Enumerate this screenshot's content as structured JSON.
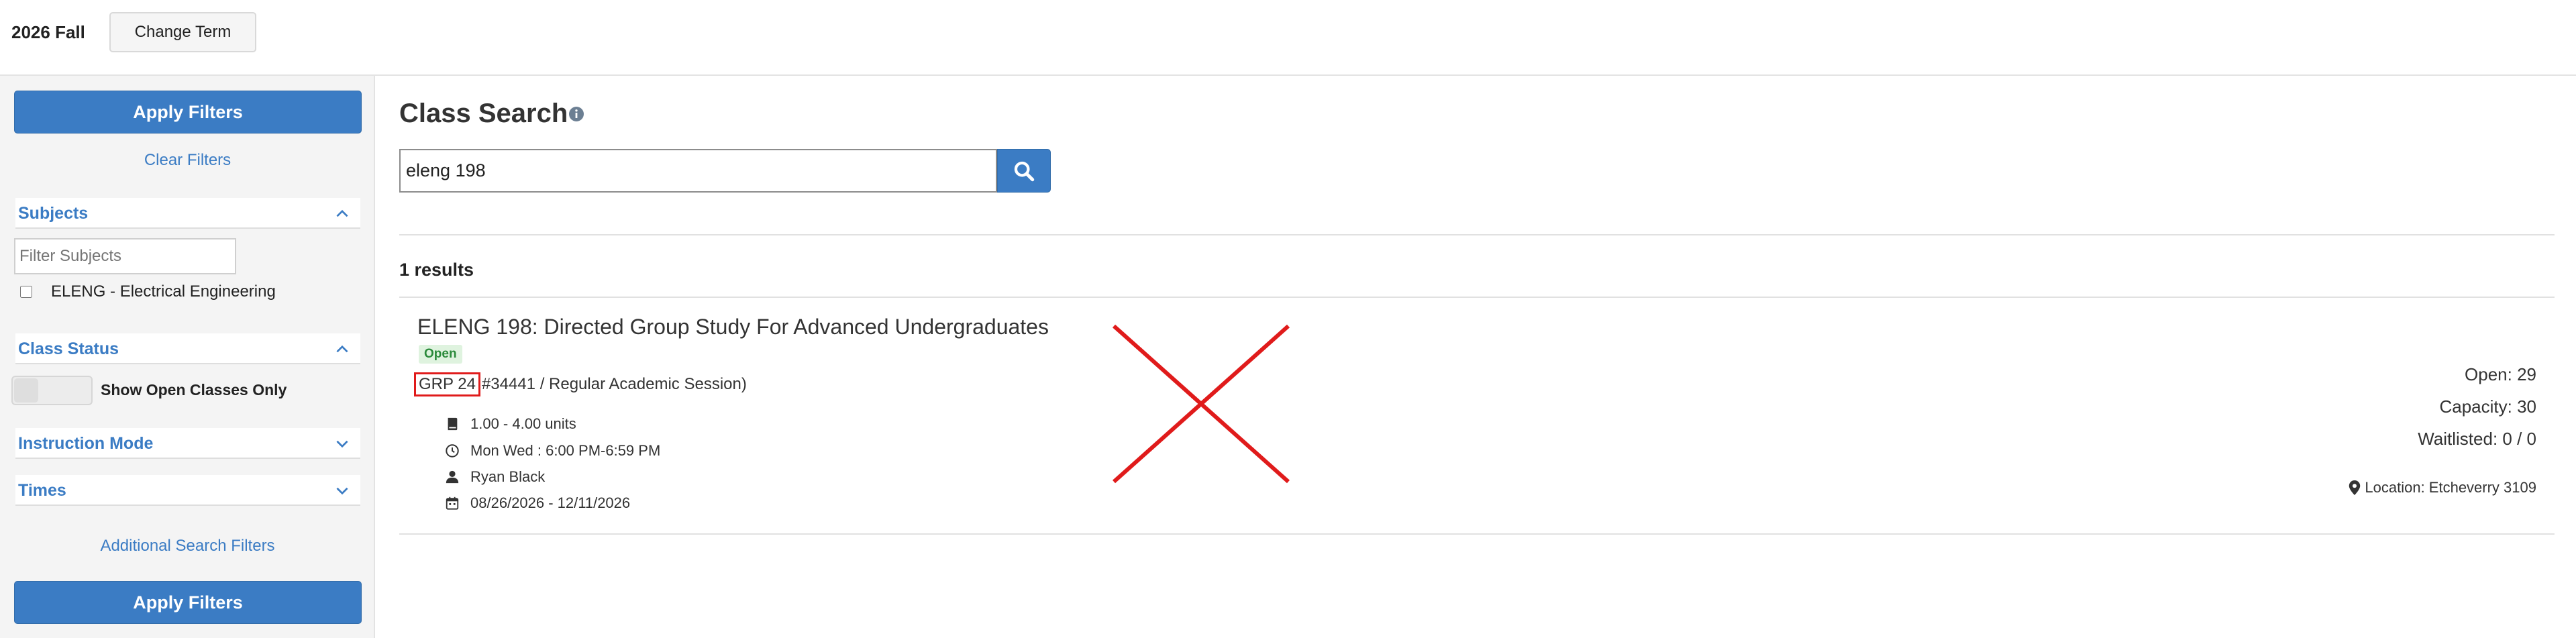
{
  "header": {
    "term": "2026 Fall",
    "change_term_label": "Change Term"
  },
  "sidebar": {
    "apply_filters_label": "Apply Filters",
    "clear_filters_label": "Clear Filters",
    "subjects": {
      "title": "Subjects",
      "filter_placeholder": "Filter Subjects",
      "options": [
        {
          "label": "ELENG - Electrical Engineering",
          "checked": false
        }
      ]
    },
    "class_status": {
      "title": "Class Status",
      "toggle_label": "Show Open Classes Only",
      "toggle_on": false
    },
    "instruction_mode": {
      "title": "Instruction Mode"
    },
    "times": {
      "title": "Times"
    },
    "additional_filters_label": "Additional Search Filters"
  },
  "main": {
    "title": "Class Search",
    "search_value": "eleng 198",
    "results_count": "1 results",
    "results": [
      {
        "title": "ELENG 198: Directed Group Study For Advanced Undergraduates",
        "status": "Open",
        "section": "GRP 24",
        "section_detail": "#34441 / Regular Academic Session)",
        "units": "1.00 - 4.00 units",
        "meeting": "Mon Wed : 6:00 PM-6:59 PM",
        "instructor": "Ryan Black",
        "dates": "08/26/2026 - 12/11/2026",
        "open": "Open: 29",
        "capacity": "Capacity: 30",
        "waitlisted": "Waitlisted: 0 / 0",
        "location": "Location: Etcheverry 3109"
      }
    ]
  },
  "colors": {
    "primary": "#3b7cc4",
    "open_badge_bg": "#dff3df",
    "open_badge_text": "#2a8a3a",
    "annotation_red": "#e01b1b"
  },
  "icons": [
    "info-icon",
    "search-icon",
    "chevron-up-icon",
    "chevron-down-icon",
    "book-icon",
    "clock-icon",
    "user-icon",
    "calendar-icon",
    "map-pin-icon",
    "x-mark-icon"
  ]
}
